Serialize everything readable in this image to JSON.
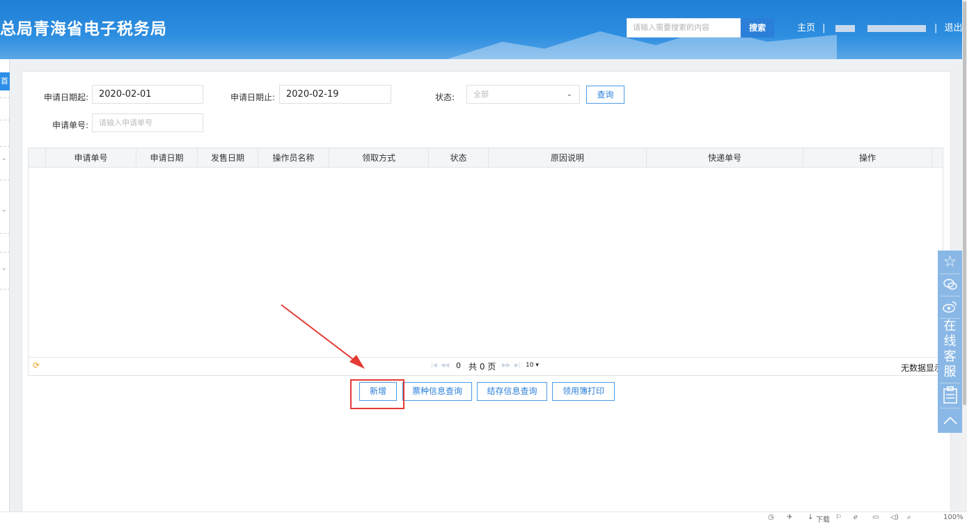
{
  "header": {
    "title": "总局青海省电子税务局",
    "search_placeholder": "请输入需要搜索的内容",
    "search_button": "搜索",
    "home_link": "主页",
    "separator": "|",
    "logout_link": "退出"
  },
  "sidebar": {
    "active_tab": "首页"
  },
  "filters": {
    "start_date_label": "申请日期起:",
    "start_date_value": "2020-02-01",
    "end_date_label": "申请日期止:",
    "end_date_value": "2020-02-19",
    "status_label": "状态:",
    "status_value": "全部",
    "query_button": "查询",
    "apply_no_label": "申请单号:",
    "apply_no_placeholder": "请输入申请单号"
  },
  "table": {
    "columns": [
      "申请单号",
      "申请日期",
      "发售日期",
      "操作员名称",
      "领取方式",
      "状态",
      "原因说明",
      "快递单号",
      "操作"
    ],
    "rows": []
  },
  "pager": {
    "current_page": "0",
    "total_pages": "共 0 页",
    "page_size": "10 ▾",
    "empty_text": "无数据显示"
  },
  "actions": {
    "add": "新增",
    "ticket_query": "票种信息查询",
    "stock_query": "结存信息查询",
    "ledger_print": "领用簿打印"
  },
  "float_bar": {
    "service_text": [
      "在",
      "线",
      "客",
      "服"
    ]
  },
  "status_bar": {
    "download": "下载",
    "zoom": "100%"
  },
  "colors": {
    "brand_blue": "#2b8ee8",
    "button_blue": "#2b7fd8",
    "highlight_red": "#e53935"
  }
}
